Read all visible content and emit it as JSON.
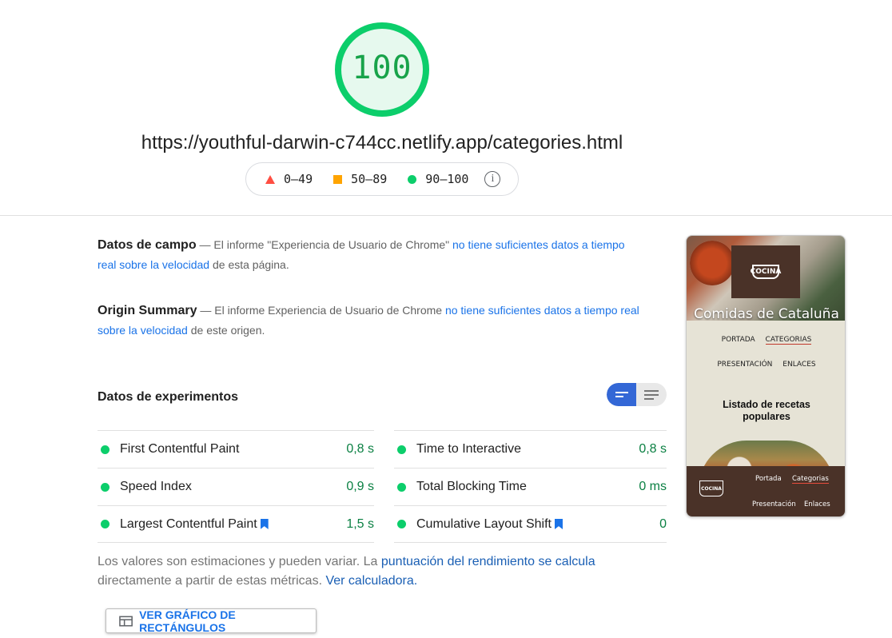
{
  "score": {
    "value": "100",
    "fraction": 1.0,
    "color": "#0cce6b"
  },
  "url": "https://youthful-darwin-c744cc.netlify.app/categories.html",
  "legend": {
    "fail": "0–49",
    "average": "50–89",
    "pass": "90–100",
    "colors": {
      "fail": "#ff4e42",
      "average": "#ffa400",
      "pass": "#0cce6b"
    }
  },
  "field_data": {
    "title": "Datos de campo",
    "pre": " — El informe \"Experiencia de Usuario de Chrome\" ",
    "link": "no tiene suficientes datos a tiempo real sobre la velocidad",
    "post": " de esta página."
  },
  "origin_summary": {
    "title": "Origin Summary",
    "pre": " — El informe Experiencia de Usuario de Chrome ",
    "link": "no tiene suficientes datos a tiempo real sobre la velocidad",
    "post": " de este origen."
  },
  "lab_data": {
    "title": "Datos de experimentos",
    "metrics_left": [
      {
        "label": "First Contentful Paint",
        "value": "0,8 s",
        "bookmark": false
      },
      {
        "label": "Speed Index",
        "value": "0,9 s",
        "bookmark": false
      },
      {
        "label": "Largest Contentful Paint",
        "value": "1,5 s",
        "bookmark": true
      }
    ],
    "metrics_right": [
      {
        "label": "Time to Interactive",
        "value": "0,8 s",
        "bookmark": false
      },
      {
        "label": "Total Blocking Time",
        "value": "0 ms",
        "bookmark": false
      },
      {
        "label": "Cumulative Layout Shift",
        "value": "0",
        "bookmark": true
      }
    ]
  },
  "note": {
    "pre": "Los valores son estimaciones y pueden variar. La ",
    "link1": "puntuación del rendimiento se calcula",
    "mid": " directamente a partir de estas métricas. ",
    "link2": "Ver calculadora."
  },
  "treemap_button": "VER GRÁFICO DE RECTÁNGULOS",
  "thumbnail": {
    "logo_text": "COCINA",
    "hero_title": "Comidas de Cataluña",
    "nav_row1": [
      "PORTADA",
      "CATEGORIAS"
    ],
    "nav_row2": [
      "PRESENTACIÓN",
      "ENLACES"
    ],
    "heading_line1": "Listado de recetas",
    "heading_line2": "populares",
    "footer_logo": "COCINA",
    "footer_links_row1": [
      "Portada",
      "Categorias"
    ],
    "footer_links_row2": [
      "Presentación",
      "Enlaces"
    ]
  }
}
